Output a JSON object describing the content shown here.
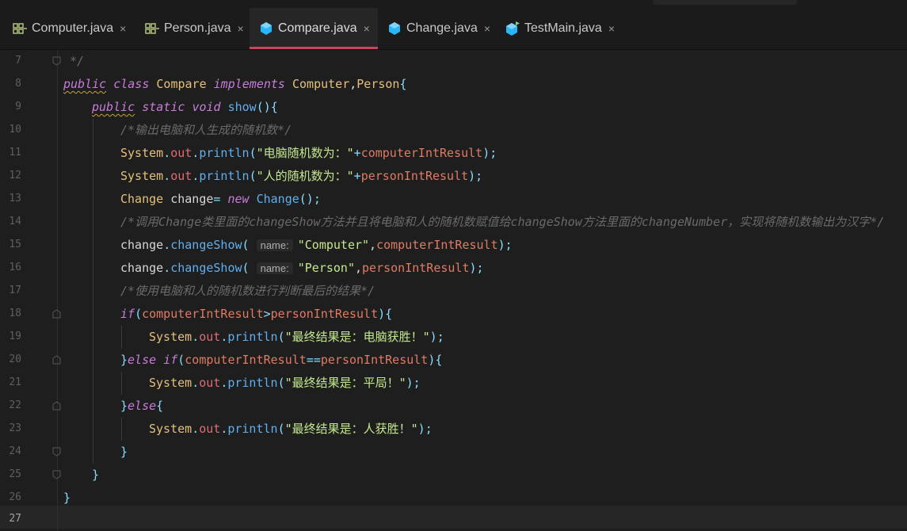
{
  "tabs": [
    {
      "label": "Computer.java",
      "icon": "interface-icon",
      "active": false
    },
    {
      "label": "Person.java",
      "icon": "interface-icon",
      "active": false
    },
    {
      "label": "Compare.java",
      "icon": "class-icon",
      "active": true
    },
    {
      "label": "Change.java",
      "icon": "class-icon",
      "active": false
    },
    {
      "label": "TestMain.java",
      "icon": "main-class-icon",
      "active": false
    }
  ],
  "close_glyph": "×",
  "colors": {
    "active_tab_underline": "#d0415e",
    "keyword": "#c77dd9",
    "class": "#e5c07b",
    "method": "#61afef",
    "string": "#c3e88d",
    "comment": "#6a6a6a"
  },
  "line_numbers": [
    "7",
    "8",
    "9",
    "10",
    "11",
    "12",
    "13",
    "14",
    "15",
    "16",
    "17",
    "18",
    "19",
    "20",
    "21",
    "22",
    "23",
    "24",
    "25",
    "26",
    "27"
  ],
  "code": {
    "l7": {
      "c": "*/"
    },
    "l8": {
      "public": "public",
      "class": "class",
      "name": "Compare",
      "implements": "implements",
      "ifaces": "Computer",
      "comma": ",",
      "iface2": "Person",
      "brace": "{"
    },
    "l9": {
      "public": "public",
      "static": "static",
      "void": "void",
      "fn": "show",
      "rest": "(){"
    },
    "l10": {
      "c": "/*输出电脑和人生成的随机数*/"
    },
    "l11": {
      "sys": "System",
      "dot1": ".",
      "out": "out",
      "dot2": ".",
      "fn": "println",
      "p1": "(",
      "str": "\"电脑随机数为：\"",
      "plus": "+",
      "var": "computerIntResult",
      "end": ");"
    },
    "l12": {
      "sys": "System",
      "dot1": ".",
      "out": "out",
      "dot2": ".",
      "fn": "println",
      "p1": "(",
      "str": "\"人的随机数为：\"",
      "plus": "+",
      "var": "personIntResult",
      "end": ");"
    },
    "l13": {
      "type": "Change",
      "var": "change",
      "eq": "=",
      "new": "new",
      "ctor": "Change",
      "end": "();"
    },
    "l14": {
      "c": "/*调用Change类里面的changeShow方法并且将电脑和人的随机数赋值给changeShow方法里面的changeNumber，实现将随机数输出为汉字*/"
    },
    "l15": {
      "obj": "change",
      "dot": ".",
      "fn": "changeShow",
      "p1": "(",
      "hint": "name:",
      "str": "\"Computer\"",
      "comma": ",",
      "var": "computerIntResult",
      "end": ");"
    },
    "l16": {
      "obj": "change",
      "dot": ".",
      "fn": "changeShow",
      "p1": "(",
      "hint": "name:",
      "str": "\"Person\"",
      "comma": ",",
      "var": "personIntResult",
      "end": ");"
    },
    "l17": {
      "c": "/*使用电脑和人的随机数进行判断最后的结果*/"
    },
    "l18": {
      "if": "if",
      "p1": "(",
      "v1": "computerIntResult",
      "op": ">",
      "v2": "personIntResult",
      "end": "){"
    },
    "l19": {
      "sys": "System",
      "dot1": ".",
      "out": "out",
      "dot2": ".",
      "fn": "println",
      "p1": "(",
      "str": "\"最终结果是：电脑获胜！\"",
      "end": ");"
    },
    "l20": {
      "rb": "}",
      "else": "else",
      "if": "if",
      "p1": "(",
      "v1": "computerIntResult",
      "op": "==",
      "v2": "personIntResult",
      "end": "){"
    },
    "l21": {
      "sys": "System",
      "dot1": ".",
      "out": "out",
      "dot2": ".",
      "fn": "println",
      "p1": "(",
      "str": "\"最终结果是：平局！\"",
      "end": ");"
    },
    "l22": {
      "rb": "}",
      "else": "else",
      "lb": "{"
    },
    "l23": {
      "sys": "System",
      "dot1": ".",
      "out": "out",
      "dot2": ".",
      "fn": "println",
      "p1": "(",
      "str": "\"最终结果是：人获胜！\"",
      "end": ");"
    },
    "l24": {
      "c": "}"
    },
    "l25": {
      "c": "}"
    },
    "l26": {
      "c": "}"
    }
  }
}
